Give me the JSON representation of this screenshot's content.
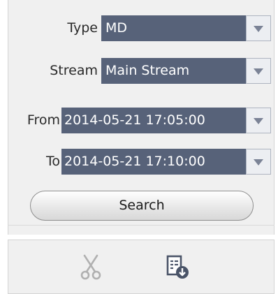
{
  "search_panel": {
    "type": {
      "label": "Type",
      "value": "MD"
    },
    "stream": {
      "label": "Stream",
      "value": "Main Stream"
    },
    "from": {
      "label": "From",
      "value": "2014-05-21 17:05:00"
    },
    "to": {
      "label": "To",
      "value": "2014-05-21 17:10:00"
    },
    "search_label": "Search"
  },
  "toolbar": {
    "icons": [
      "scissors-icon",
      "download-file-icon"
    ]
  },
  "colors": {
    "select_bg": "#576279",
    "select_text": "#ffffff",
    "panel_bg": "#f0f0f0",
    "icon_disabled": "#b0b0b0",
    "icon_active": "#4a5468"
  }
}
